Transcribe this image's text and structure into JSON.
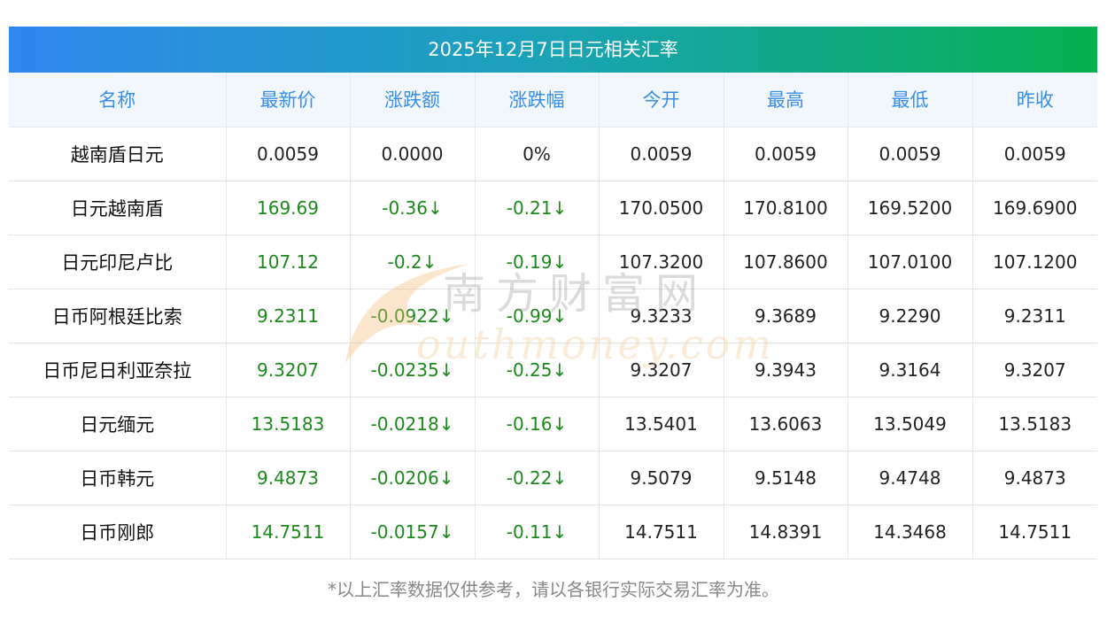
{
  "title": "2025年12月7日日元相关汇率",
  "columns": [
    "名称",
    "最新价",
    "涨跌额",
    "涨跌幅",
    "今开",
    "最高",
    "最低",
    "昨收"
  ],
  "rows": [
    {
      "name": "越南盾日元",
      "latest": "0.0059",
      "change": "0.0000",
      "pct": "0%",
      "open": "0.0059",
      "high": "0.0059",
      "low": "0.0059",
      "prev": "0.0059",
      "down": false
    },
    {
      "name": "日元越南盾",
      "latest": "169.69",
      "change": "-0.36↓",
      "pct": "-0.21↓",
      "open": "170.0500",
      "high": "170.8100",
      "low": "169.5200",
      "prev": "169.6900",
      "down": true
    },
    {
      "name": "日元印尼卢比",
      "latest": "107.12",
      "change": "-0.2↓",
      "pct": "-0.19↓",
      "open": "107.3200",
      "high": "107.8600",
      "low": "107.0100",
      "prev": "107.1200",
      "down": true
    },
    {
      "name": "日币阿根廷比索",
      "latest": "9.2311",
      "change": "-0.0922↓",
      "pct": "-0.99↓",
      "open": "9.3233",
      "high": "9.3689",
      "low": "9.2290",
      "prev": "9.2311",
      "down": true
    },
    {
      "name": "日币尼日利亚奈拉",
      "latest": "9.3207",
      "change": "-0.0235↓",
      "pct": "-0.25↓",
      "open": "9.3207",
      "high": "9.3943",
      "low": "9.3164",
      "prev": "9.3207",
      "down": true
    },
    {
      "name": "日元缅元",
      "latest": "13.5183",
      "change": "-0.0218↓",
      "pct": "-0.16↓",
      "open": "13.5401",
      "high": "13.6063",
      "low": "13.5049",
      "prev": "13.5183",
      "down": true
    },
    {
      "name": "日币韩元",
      "latest": "9.4873",
      "change": "-0.0206↓",
      "pct": "-0.22↓",
      "open": "9.5079",
      "high": "9.5148",
      "low": "9.4748",
      "prev": "9.4873",
      "down": true
    },
    {
      "name": "日币刚郎",
      "latest": "14.7511",
      "change": "-0.0157↓",
      "pct": "-0.11↓",
      "open": "14.7511",
      "high": "14.8391",
      "low": "14.3468",
      "prev": "14.7511",
      "down": true
    }
  ],
  "note": "*以上汇率数据仅供参考，请以各银行实际交易汇率为准。",
  "watermark": {
    "cn": "南方财富网",
    "en": "outhmoney.com"
  },
  "colors": {
    "header_text": "#3a8ee6",
    "down": "#1b8a1b",
    "gradient_start": "#2f87ee",
    "gradient_end": "#06b04f"
  }
}
